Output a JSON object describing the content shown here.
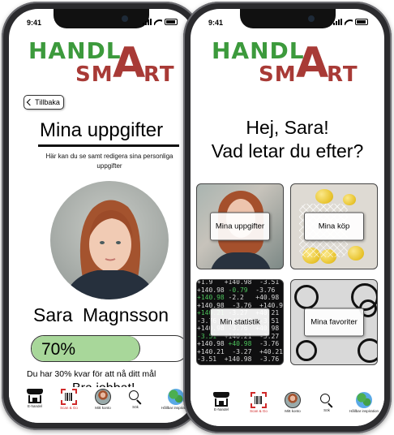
{
  "status_bar": {
    "time": "9:41"
  },
  "logo": {
    "word1": "HANDL",
    "word2": "SM",
    "big_letter": "A",
    "word3": "RT"
  },
  "left_screen": {
    "back_label": "Tillbaka",
    "title": "Mina uppgifter",
    "subtitle": "Här kan du se samt redigera sina personliga uppgifter",
    "user_name": "Sara  Magnsson",
    "progress": {
      "value": 0.7,
      "label": "70%"
    },
    "progress_message": "Du har 30% kvar för att nå ditt mål",
    "praise": "Bra jobbat!"
  },
  "right_screen": {
    "greeting_line1": "Hej, Sara!",
    "greeting_line2": "Vad letar du efter?",
    "tiles": [
      {
        "label": "Mina uppgifter",
        "image": "woman-portrait"
      },
      {
        "label": "Mina köp",
        "image": "lemons-in-net-bag"
      },
      {
        "label": "Min statistik",
        "image": "stock-numbers"
      },
      {
        "label": "Mina favoriter",
        "image": "emoji-outline-icons"
      }
    ]
  },
  "bottom_nav": {
    "items": [
      {
        "label": "E-handel",
        "icon": "shop-icon"
      },
      {
        "label": "Scan & Go",
        "icon": "barcode-scan-icon"
      },
      {
        "label": "Mitt konto",
        "icon": "account-avatar-icon"
      },
      {
        "label": "Sök",
        "icon": "search-icon"
      },
      {
        "label": "Hållbar inspiration",
        "icon": "globe-icon"
      }
    ]
  },
  "colors": {
    "logo_green": "#3c9a3c",
    "logo_red": "#a83a36",
    "progress_fill": "#a8d79a",
    "phone_frame": "#2b2b2e"
  }
}
